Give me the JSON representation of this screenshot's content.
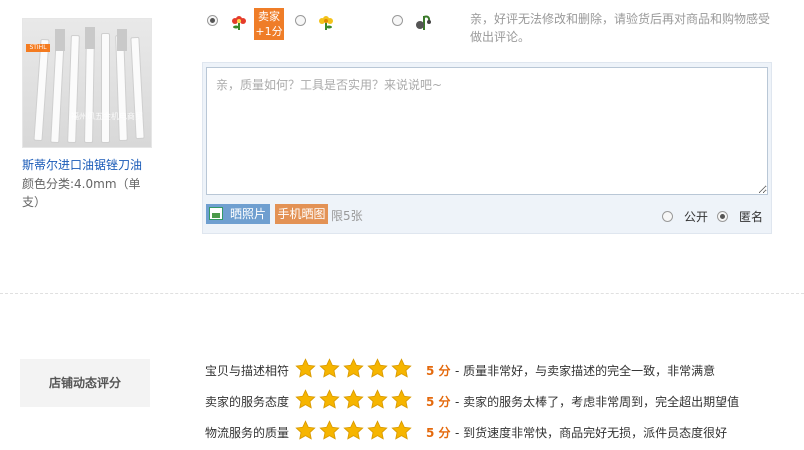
{
  "product": {
    "title": "斯蒂尔进口油锯锉刀油",
    "spec": "颜色分类:4.0mm（单支）",
    "logo_text": "STIHL",
    "watermark": "福州凤五金机电商贸"
  },
  "rating": {
    "options": [
      {
        "name": "good",
        "selected": true
      },
      {
        "name": "neutral",
        "selected": false
      },
      {
        "name": "bad",
        "selected": false
      }
    ],
    "bonus_line1": "卖家",
    "bonus_line2": "+1分",
    "notice": "亲，好评无法修改和删除，请验货后再对商品和购物感受做出评论。"
  },
  "review": {
    "placeholder": "亲，质量如何？工具是否实用？来说说吧~",
    "value": "",
    "photo_button": "晒照片",
    "mobile_button": "手机晒图",
    "limit": "限5张",
    "visibility_public": "公开",
    "visibility_anonymous": "匿名",
    "anonymous_selected": true
  },
  "shop_rating": {
    "title": "店铺动态评分",
    "rows": [
      {
        "label": "宝贝与描述相符",
        "stars": 5,
        "score": "5 分",
        "desc": "- 质量非常好，与卖家描述的完全一致，非常满意"
      },
      {
        "label": "卖家的服务态度",
        "stars": 5,
        "score": "5 分",
        "desc": "- 卖家的服务太棒了，考虑非常周到，完全超出期望值"
      },
      {
        "label": "物流服务的质量",
        "stars": 5,
        "score": "5 分",
        "desc": "- 到货速度非常快，商品完好无损，派件员态度很好"
      }
    ]
  },
  "colors": {
    "accent_orange": "#ef7d28",
    "link_blue": "#1a5bb8",
    "star_gold": "#f6b500",
    "score_orange": "#e4690c"
  }
}
